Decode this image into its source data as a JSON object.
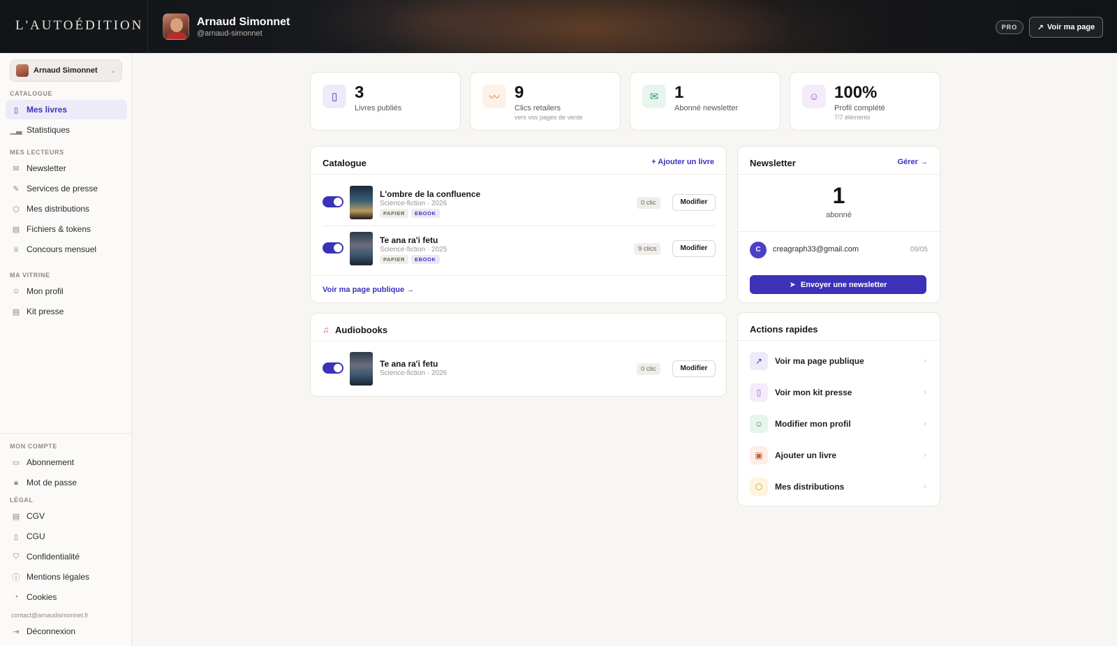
{
  "header": {
    "brand": "L'AUTOÉDITION",
    "name": "Arnaud Simonnet",
    "handle": "@arnaud-simonnet",
    "pro_label": "PRO",
    "voir_ma_page": "Voir ma page"
  },
  "sidebar": {
    "user_name": "Arnaud Simonnet",
    "sections": {
      "catalogue": "CATALOGUE",
      "lecteurs": "MES LECTEURS",
      "vitrine": "MA VITRINE",
      "compte": "MON COMPTE",
      "legal": "LÉGAL"
    },
    "items": {
      "mes_livres": "Mes livres",
      "statistiques": "Statistiques",
      "newsletter": "Newsletter",
      "services_presse": "Services de presse",
      "distributions": "Mes distributions",
      "fichiers": "Fichiers & tokens",
      "concours": "Concours mensuel",
      "profil": "Mon profil",
      "kit_presse": "Kit presse",
      "abonnement": "Abonnement",
      "mot_de_passe": "Mot de passe",
      "cgv": "CGV",
      "cgu": "CGU",
      "confidentialite": "Confidentialité",
      "mentions": "Mentions légales",
      "cookies": "Cookies"
    },
    "contact": "contact@arnaudsimonnet.fr",
    "logout": "Déconnexion"
  },
  "stats": [
    {
      "value": "3",
      "label": "Livres publiés",
      "sub": ""
    },
    {
      "value": "9",
      "label": "Clics retailers",
      "sub": "vers vos pages de vente"
    },
    {
      "value": "1",
      "label": "Abonné newsletter",
      "sub": ""
    },
    {
      "value": "100%",
      "label": "Profil complété",
      "sub": "7/7 éléments"
    }
  ],
  "catalogue": {
    "title": "Catalogue",
    "add_link": "+ Ajouter un livre",
    "books": [
      {
        "title": "L'ombre de la confluence",
        "meta": "Science-fiction · 2026",
        "tag1": "PAPIER",
        "tag2": "EBOOK",
        "clics": "0 clic",
        "action": "Modifier"
      },
      {
        "title": "Te ana ra'i fetu",
        "meta": "Science-fiction · 2025",
        "tag1": "PAPIER",
        "tag2": "EBOOK",
        "clics": "9 clics",
        "action": "Modifier"
      }
    ],
    "public_link": "Voir ma page publique →"
  },
  "audiobooks": {
    "title": "Audiobooks",
    "items": [
      {
        "title": "Te ana ra'i fetu",
        "meta": "Science-fiction · 2026",
        "clics": "0 clic",
        "action": "Modifier"
      }
    ]
  },
  "newsletter": {
    "title": "Newsletter",
    "manage": "Gérer →",
    "count": "1",
    "unit": "abonné",
    "subscriber": {
      "initial": "C",
      "email": "creagraph33@gmail.com",
      "date": "09/05"
    },
    "send": "Envoyer une newsletter"
  },
  "quick_actions": {
    "title": "Actions rapides",
    "items": [
      {
        "label": "Voir ma page publique"
      },
      {
        "label": "Voir mon kit presse"
      },
      {
        "label": "Modifier mon profil"
      },
      {
        "label": "Ajouter un livre"
      },
      {
        "label": "Mes distributions"
      }
    ]
  },
  "colors": {
    "accent": "#3c32b8",
    "header_bg": "#101418",
    "page_bg": "#f7f6f3"
  }
}
